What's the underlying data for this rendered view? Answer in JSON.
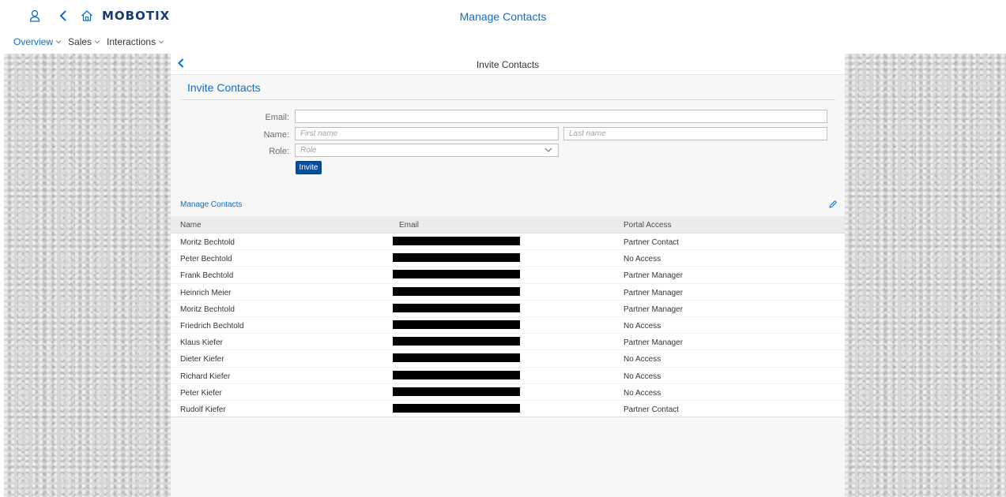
{
  "shell": {
    "brand": "MOBOTIX",
    "title": "Manage Contacts",
    "icons": [
      "user-icon",
      "back-arrow-icon",
      "home-icon"
    ]
  },
  "menu": [
    {
      "label": "Overview"
    },
    {
      "label": "Sales"
    },
    {
      "label": "Interactions"
    }
  ],
  "panel": {
    "header_title": "Invite Contacts",
    "form_title": "Invite Contacts",
    "email_label": "Email:",
    "email_value": "",
    "name_label": "Name:",
    "first_name_placeholder": "First name",
    "last_name_placeholder": "Last name",
    "role_label": "Role:",
    "role_placeholder": "Role",
    "invite_label": "Invite"
  },
  "contacts": {
    "title": "Manage Contacts",
    "columns": [
      "Name",
      "Email",
      "Portal Access"
    ],
    "rows": [
      {
        "name": "Moritz Bechtold",
        "access": "Partner Contact"
      },
      {
        "name": "Peter Bechtold",
        "access": "No Access"
      },
      {
        "name": "Frank Bechtold",
        "access": "Partner Manager"
      },
      {
        "name": "Heinrich Meier",
        "access": "Partner Manager"
      },
      {
        "name": "Moritz Bechtold",
        "access": "Partner Manager"
      },
      {
        "name": "Friedrich Bechtold",
        "access": "No Access"
      },
      {
        "name": "Klaus Kiefer",
        "access": "Partner Manager"
      },
      {
        "name": "Dieter Kiefer",
        "access": "No Access"
      },
      {
        "name": "Richard Kiefer",
        "access": "No Access"
      },
      {
        "name": "Peter Kiefer",
        "access": "No Access"
      },
      {
        "name": "Rudolf Kiefer",
        "access": "Partner Contact"
      }
    ]
  },
  "colors": {
    "accent": "#0a6ed1",
    "brand": "#1a3a6b",
    "button": "#0a4e9b"
  }
}
